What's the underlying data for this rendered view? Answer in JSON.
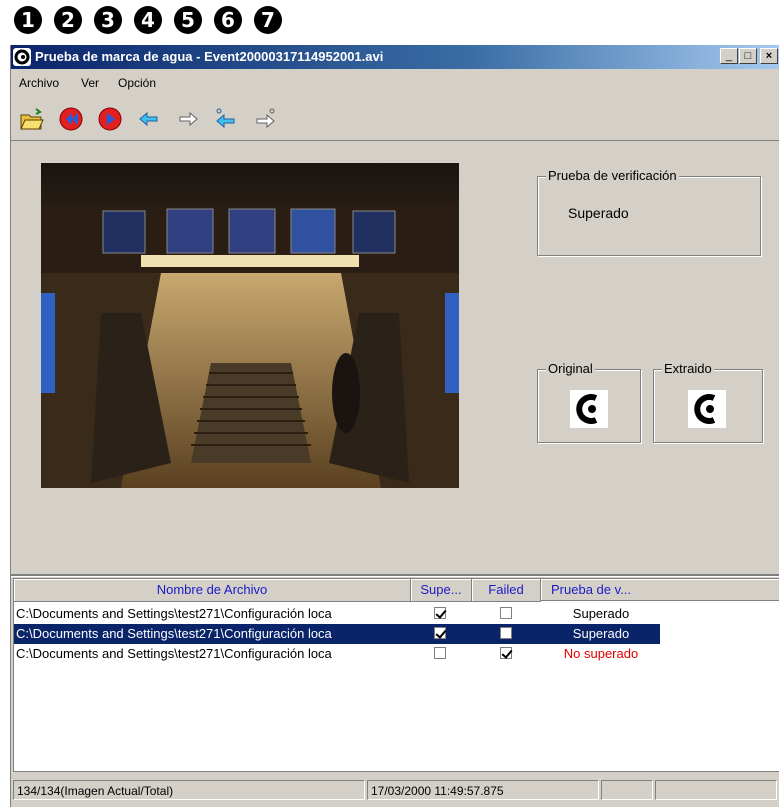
{
  "callouts": [
    "1",
    "2",
    "3",
    "4",
    "5",
    "6",
    "7"
  ],
  "window": {
    "title": "Prueba de marca de agua - Event20000317114952001.avi",
    "buttons": {
      "minimize": "_",
      "maximize": "□",
      "close": "×"
    }
  },
  "menu": [
    "Archivo",
    "Ver",
    "Opción"
  ],
  "toolbar": {
    "icons": [
      "open-folder-icon",
      "rewind-icon",
      "play-icon",
      "back-arrow-icon",
      "forward-arrow-icon",
      "step-back-icon",
      "step-forward-icon"
    ]
  },
  "verification": {
    "label": "Prueba de verificación",
    "value": "Superado"
  },
  "original": {
    "label": "Original"
  },
  "extracted": {
    "label": "Extraido"
  },
  "table": {
    "headers": [
      "Nombre de Archivo",
      "Supe...",
      "Failed",
      "Prueba de v..."
    ],
    "rows": [
      {
        "file": "C:\\Documents and Settings\\test271\\Configuración loca",
        "passed": true,
        "failed": false,
        "result": "Superado",
        "result_color": "#000000"
      },
      {
        "file": "C:\\Documents and Settings\\test271\\Configuración loca",
        "passed": true,
        "failed": false,
        "result": "Superado",
        "result_color": "#ffffff"
      },
      {
        "file": "C:\\Documents and Settings\\test271\\Configuración loca",
        "passed": false,
        "failed": true,
        "result": "No superado",
        "result_color": "#e00000"
      }
    ]
  },
  "status": {
    "frames": "134/134(Imagen Actual/Total)",
    "datetime": "17/03/2000 11:49:57.875"
  },
  "colors": {
    "title_bar": "#0a246a",
    "selection": "#0a246a",
    "header_text": "#1a1ac8",
    "fail": "#e00000"
  }
}
